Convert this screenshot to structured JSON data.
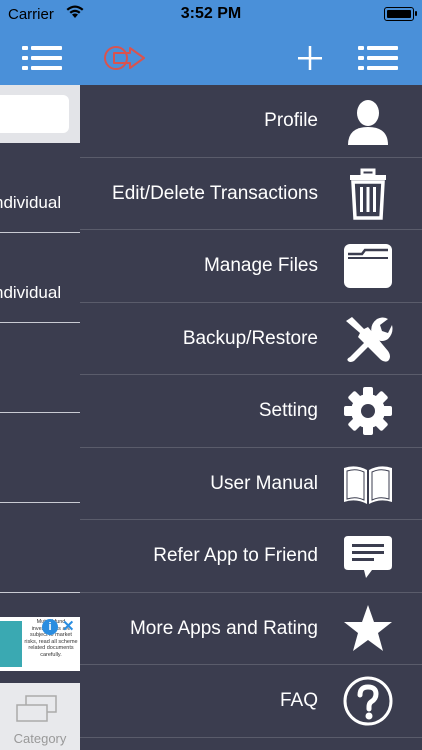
{
  "status_bar": {
    "carrier": "Carrier",
    "time": "3:52 PM"
  },
  "navbar": {
    "left_icon": "list-menu-icon",
    "logo_icon": "logout-arrow-icon",
    "plus_icon": "plus-icon",
    "right_icon": "list-menu-icon"
  },
  "left_panel": {
    "rows": [
      "ndividual",
      "ndividual",
      "",
      "",
      ""
    ],
    "ad_text": "Mutual fund investments are subject to market risks, read all scheme related documents carefully.",
    "tab_label": "Category"
  },
  "menu": {
    "items": [
      {
        "label": "Profile",
        "icon": "profile-icon"
      },
      {
        "label": "Edit/Delete Transactions",
        "icon": "trash-icon"
      },
      {
        "label": "Manage Files",
        "icon": "folder-icon"
      },
      {
        "label": "Backup/Restore",
        "icon": "tools-icon"
      },
      {
        "label": "Setting",
        "icon": "gear-icon"
      },
      {
        "label": "User Manual",
        "icon": "book-icon"
      },
      {
        "label": "Refer App to Friend",
        "icon": "message-icon"
      },
      {
        "label": "More Apps and Rating",
        "icon": "star-icon"
      },
      {
        "label": "FAQ",
        "icon": "question-icon"
      }
    ]
  },
  "colors": {
    "header_blue": "#4a90d9",
    "drawer_bg": "#3b3d4f",
    "divider": "#5a5c6b",
    "icon_white": "#ffffff"
  }
}
